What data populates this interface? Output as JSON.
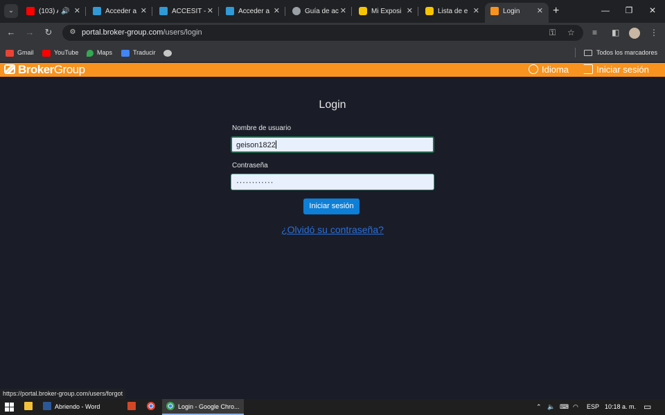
{
  "browser": {
    "tabs": [
      {
        "title": "(103) A",
        "favicon": "youtube-favicon",
        "color": "#ff0000",
        "audio": "🔊"
      },
      {
        "title": "Acceder a",
        "favicon": "accesit-favicon",
        "color": "#2f9ad6"
      },
      {
        "title": "ACCESIT -",
        "favicon": "accesit-favicon",
        "color": "#2f9ad6"
      },
      {
        "title": "Acceder a",
        "favicon": "accesit-favicon",
        "color": "#2f9ad6"
      },
      {
        "title": "Guía de ac",
        "favicon": "globe-favicon",
        "color": "#9aa0a6"
      },
      {
        "title": "Mi Exposi",
        "favicon": "broker-favicon",
        "color": "#f7c400"
      },
      {
        "title": "Lista de e",
        "favicon": "broker-favicon",
        "color": "#f7c400"
      },
      {
        "title": "Login",
        "favicon": "brokergroup-favicon",
        "color": "#f7931e",
        "active": true
      }
    ],
    "new_tab": "+",
    "window_controls": {
      "minimize": "—",
      "restore": "❐",
      "close": "✕"
    },
    "url_host": "portal.broker-group.com",
    "url_path": "/users/login",
    "bookmarks": [
      {
        "label": "Gmail",
        "icon": "gmail-icon",
        "color": "#ea4335"
      },
      {
        "label": "YouTube",
        "icon": "youtube-icon",
        "color": "#ff0000"
      },
      {
        "label": "Maps",
        "icon": "maps-icon",
        "color": "#34a853"
      },
      {
        "label": "Traducir",
        "icon": "translate-icon",
        "color": "#4285f4"
      },
      {
        "label": "",
        "icon": "custom-bookmark-icon",
        "color": "#c4c7c5"
      }
    ],
    "all_bookmarks": "Todos los marcadores"
  },
  "site": {
    "logo_bold": "Broker",
    "logo_light": "Group",
    "language_link": "Idioma",
    "login_link": "Iniciar sesión",
    "brand_color": "#f7931e"
  },
  "login": {
    "title": "Login",
    "username_label": "Nombre de usuario",
    "username_value": "geison1822",
    "password_label": "Contraseña",
    "password_value": "············",
    "submit_label": "Iniciar sesión",
    "forgot_link": "¿Olvidó su contraseña?"
  },
  "status_url": "https://portal.broker-group.com/users/forgot",
  "taskbar": {
    "items": [
      {
        "label": "",
        "icon": "file-explorer-icon"
      },
      {
        "label": "Abriendo - Word",
        "icon": "word-icon"
      },
      {
        "label": "",
        "icon": "powerpoint-icon"
      },
      {
        "label": "",
        "icon": "chrome-icon"
      },
      {
        "label": "Login - Google Chro...",
        "icon": "chrome-icon",
        "active": true
      }
    ],
    "language": "ESP",
    "time": "10:18 a. m."
  }
}
